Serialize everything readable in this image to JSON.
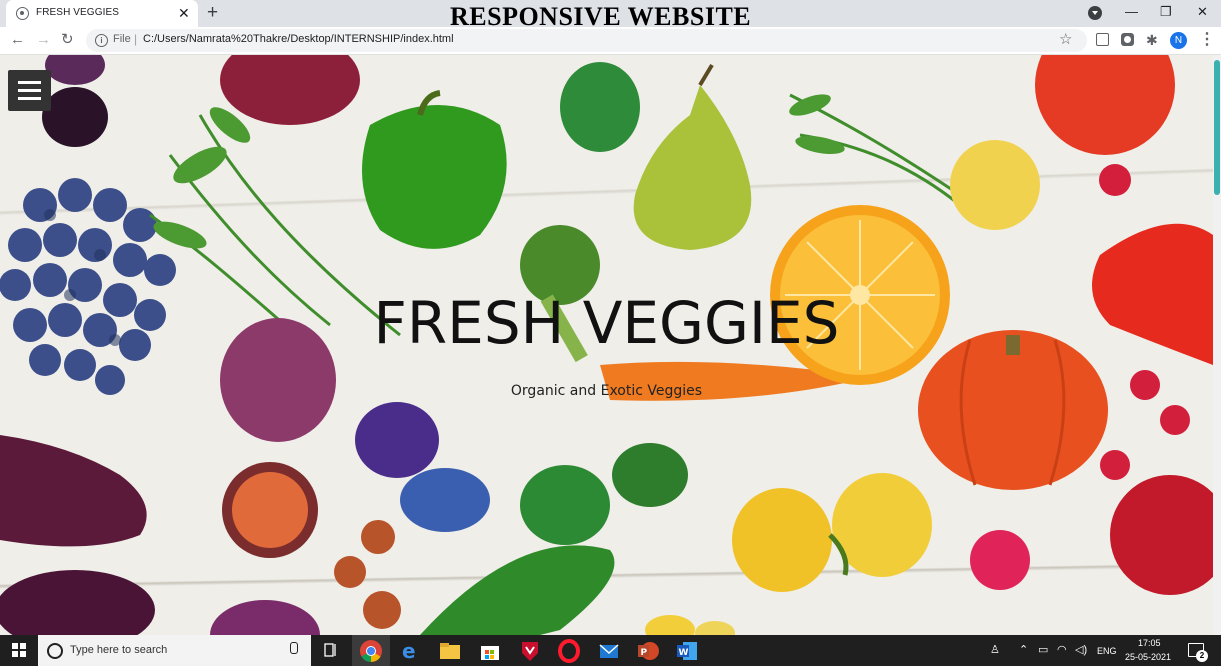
{
  "browser": {
    "tab_title": "FRESH VEGGIES",
    "tab_close": "✕",
    "new_tab": "+",
    "overlay_title": "RESPONSIVE WEBSITE",
    "window_controls": {
      "minimize": "—",
      "restore": "❐",
      "close": "✕"
    },
    "toolbar": {
      "back": "←",
      "forward": "→",
      "reload": "↻",
      "info_glyph": "i",
      "scheme": "File",
      "separator": "|",
      "url": "C:/Users/Namrata%20Thakre/Desktop/INTERNSHIP/index.html",
      "star": "☆",
      "profile_initial": "N",
      "menu": "⋮"
    }
  },
  "page": {
    "hero_title": "FRESH VEGGIES",
    "hero_subtitle": "Organic and Exotic Veggies"
  },
  "taskbar": {
    "search_placeholder": "Type here to search",
    "tray": {
      "language": "ENG",
      "time": "17:05",
      "date": "25-05-2021",
      "notification_count": "2"
    }
  },
  "colors": {
    "hamburger_bg": "#333333",
    "chrome_frame": "#dee1e6",
    "taskbar_bg": "#1f1f1f",
    "scroll_thumb": "#3ab0b0",
    "profile_avatar": "#1a73e8"
  }
}
